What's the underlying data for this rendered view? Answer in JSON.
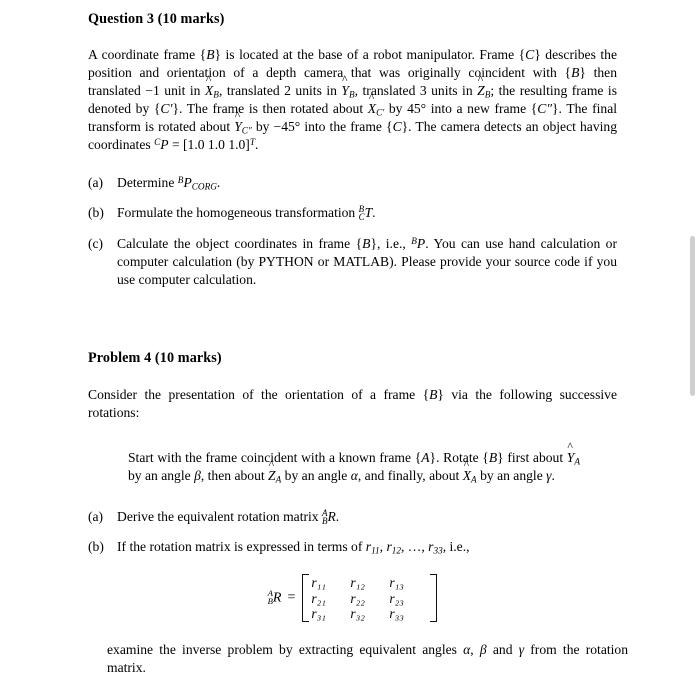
{
  "document": {
    "question3": {
      "heading": "Question 3 (10 marks)",
      "body_parts": {
        "p1_a": "A coordinate frame {",
        "p1_B1": "B",
        "p1_b": "} is located at the base of a robot manipulator. Frame {",
        "p1_C1": "C",
        "p1_c": "} describes the position and orientation of a depth camera that was originally coincident with {",
        "p1_B2": "B",
        "p1_d": "} then translated −1 unit in ",
        "p1_X": "X",
        "p1_Xsub": "B",
        "p1_e": ", translated 2 units in ",
        "p1_Y": "Y",
        "p1_Ysub": "B",
        "p1_f": ", translated 3 units in ",
        "p1_Z": "Z",
        "p1_Zsub": "B",
        "p1_g": "; the resulting frame is denoted by {",
        "p1_Cp": "C′",
        "p1_h": "}. The frame is then rotated about ",
        "p1_X2": "X",
        "p1_X2sub": "C′",
        "p1_i": " by 45° into a new frame {",
        "p1_Cpp": "C″",
        "p1_j": "}. The final transform is rotated about ",
        "p1_Y2": "Y",
        "p1_Y2sub": "C″",
        "p1_k": " by −45° into the frame {",
        "p1_C2": "C",
        "p1_l": "}. The camera detects an object having coordinates ",
        "p1_Psup": "C",
        "p1_P": "P",
        "p1_m": " = [1.0  1.0  1.0]",
        "p1_T": "T",
        "p1_n": "."
      },
      "items": [
        {
          "marker": "(a)",
          "text_1": "Determine ",
          "sup": "B",
          "sym": "P",
          "sub": "CORG",
          "text_2": "."
        },
        {
          "marker": "(b)",
          "text_1": "Formulate the homogeneous transformation ",
          "pre_sup": "B",
          "pre_sub": "C",
          "sym": "T",
          "text_2": "."
        },
        {
          "marker": "(c)",
          "text_1": "Calculate the object coordinates in frame {",
          "frame": "B",
          "text_2": "}, i.e., ",
          "sup": "B",
          "sym": "P",
          "text_3": ". You can use hand calculation or computer calculation (by PYTHON or MATLAB). Please provide your source code if you use computer calculation."
        }
      ]
    },
    "problem4": {
      "heading": "Problem 4 (10 marks)",
      "intro_parts": {
        "a": "Consider the presentation of the orientation of a frame {",
        "B": "B",
        "b": "} via the following successive rotations:"
      },
      "quote_parts": {
        "a": "Start with the frame coincident with a known frame {",
        "A1": "A",
        "b": "}. Rotate {",
        "B1": "B",
        "c": "} first about ",
        "Y": "Y",
        "Ysub": "A",
        "d": " by an angle ",
        "beta": "β",
        "e": ", then about ",
        "Z": "Z",
        "Zsub": "A",
        "f": " by an angle ",
        "alpha": "α",
        "g": ", and finally, about ",
        "X": "X",
        "Xsub": "A",
        "h": " by an angle ",
        "gamma": "γ",
        "i": "."
      },
      "items": [
        {
          "marker": "(a)",
          "text_1": "Derive the equivalent rotation matrix ",
          "pre_sup": "A",
          "pre_sub": "B",
          "sym": "R",
          "text_2": "."
        },
        {
          "marker": "(b)",
          "text_1": "If the rotation matrix is expressed in terms of ",
          "r1": "r",
          "r1sub": "11",
          "c1": ", ",
          "r2": "r",
          "r2sub": "12",
          "c2": ", …, ",
          "r3": "r",
          "r3sub": "33",
          "text_2": ", i.e.,"
        }
      ],
      "equation": {
        "lhs_sup": "A",
        "lhs_sub": "B",
        "lhs_sym": "R",
        "equals": "=",
        "matrix": [
          [
            "r₁₁",
            "r₁₂",
            "r₁₃"
          ],
          [
            "r₂₁",
            "r₂₂",
            "r₂₃"
          ],
          [
            "r₃₁",
            "r₃₂",
            "r₃₃"
          ]
        ]
      },
      "closing_parts": {
        "a": "examine the inverse problem by extracting equivalent angles ",
        "alpha": "α",
        "b": ", ",
        "beta": "β",
        "c": " and ",
        "gamma": "γ",
        "d": " from the rotation matrix."
      }
    }
  },
  "scrollbar": {
    "thumb_color": "#cfcfcf"
  }
}
